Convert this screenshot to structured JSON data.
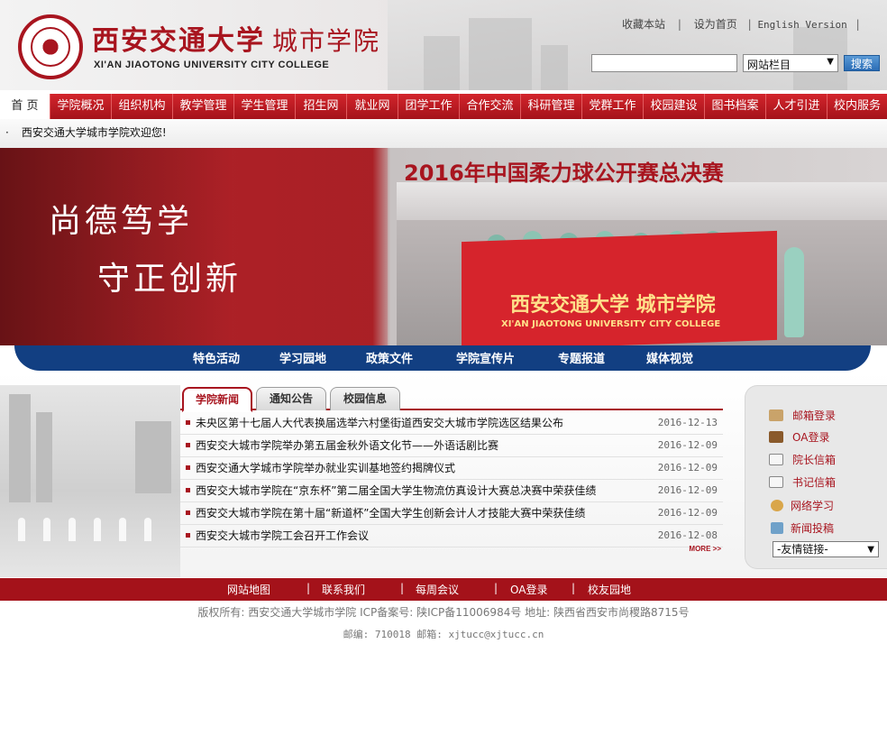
{
  "header": {
    "logo_cn": "西安交通大学",
    "logo_cn_sub": "城市学院",
    "logo_en": "XI'AN JIAOTONG UNIVERSITY CITY COLLEGE",
    "top_links": [
      "收藏本站",
      "设为首页",
      "English Version"
    ],
    "search_select": "网站栏目",
    "search_button": "搜索"
  },
  "nav": {
    "items": [
      "首 页",
      "学院概况",
      "组织机构",
      "教学管理",
      "学生管理",
      "招生网",
      "就业网",
      "团学工作",
      "合作交流",
      "科研管理",
      "党群工作",
      "校园建设",
      "图书档案",
      "人才引进",
      "校内服务"
    ]
  },
  "welcome": {
    "bullet": "·",
    "text": "西安交通大学城市学院欢迎您!"
  },
  "banner": {
    "slogan_1": "尚德笃学",
    "slogan_2": "守正创新",
    "event_title": "2016年中国柔力球公开赛总决赛",
    "flag_cn": "西安交通大学 城市学院",
    "flag_en": "XI'AN JIAOTONG UNIVERSITY CITY COLLEGE"
  },
  "subnav": {
    "items": [
      "特色活动",
      "学习园地",
      "政策文件",
      "学院宣传片",
      "专题报道",
      "媒体视觉"
    ]
  },
  "news": {
    "tabs": [
      "学院新闻",
      "通知公告",
      "校园信息"
    ],
    "items": [
      {
        "title": "未央区第十七届人大代表换届选举六村堡街道西安交大城市学院选区结果公布",
        "date": "2016-12-13"
      },
      {
        "title": "西安交大城市学院举办第五届金秋外语文化节——外语话剧比赛",
        "date": "2016-12-09"
      },
      {
        "title": "西安交通大学城市学院举办就业实训基地签约揭牌仪式",
        "date": "2016-12-09"
      },
      {
        "title": "西安交大城市学院在“京东杯”第二届全国大学生物流仿真设计大赛总决赛中荣获佳绩",
        "date": "2016-12-09"
      },
      {
        "title": "西安交大城市学院在第十届“新道杯”全国大学生创新会计人才技能大赛中荣获佳绩",
        "date": "2016-12-09"
      },
      {
        "title": "西安交大城市学院工会召开工作会议",
        "date": "2016-12-08"
      }
    ],
    "more": "MORE >>"
  },
  "side": {
    "links": [
      "邮箱登录",
      "OA登录",
      "院长信箱",
      "书记信箱",
      "网络学习",
      "新闻投稿"
    ],
    "friend_links": "-友情链接-"
  },
  "footer": {
    "links": [
      "网站地图",
      "联系我们",
      "每周会议",
      "OA登录",
      "校友园地"
    ],
    "copyright": "版权所有: 西安交通大学城市学院  ICP备案号:  陕ICP备11006984号  地址: 陕西省西安市尚稷路8715号",
    "contact": "邮编: 710018      邮箱: xjtucc@xjtucc.cn"
  },
  "colors": {
    "brand_red": "#a8151f",
    "nav_blue": "#123f82"
  }
}
